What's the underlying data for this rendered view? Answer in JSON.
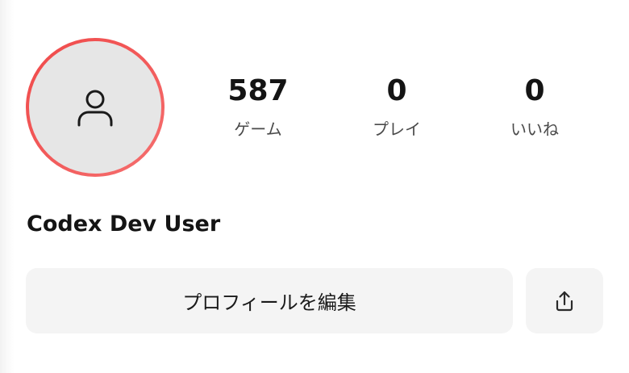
{
  "profile": {
    "avatar_icon": "user-icon",
    "ring_color": "#f04a4a",
    "display_name": "Codex Dev User"
  },
  "stats": [
    {
      "value": "587",
      "label": "ゲーム"
    },
    {
      "value": "0",
      "label": "プレイ"
    },
    {
      "value": "0",
      "label": "いいね"
    }
  ],
  "actions": {
    "edit_profile_label": "プロフィールを編集",
    "share_icon": "share-icon"
  }
}
